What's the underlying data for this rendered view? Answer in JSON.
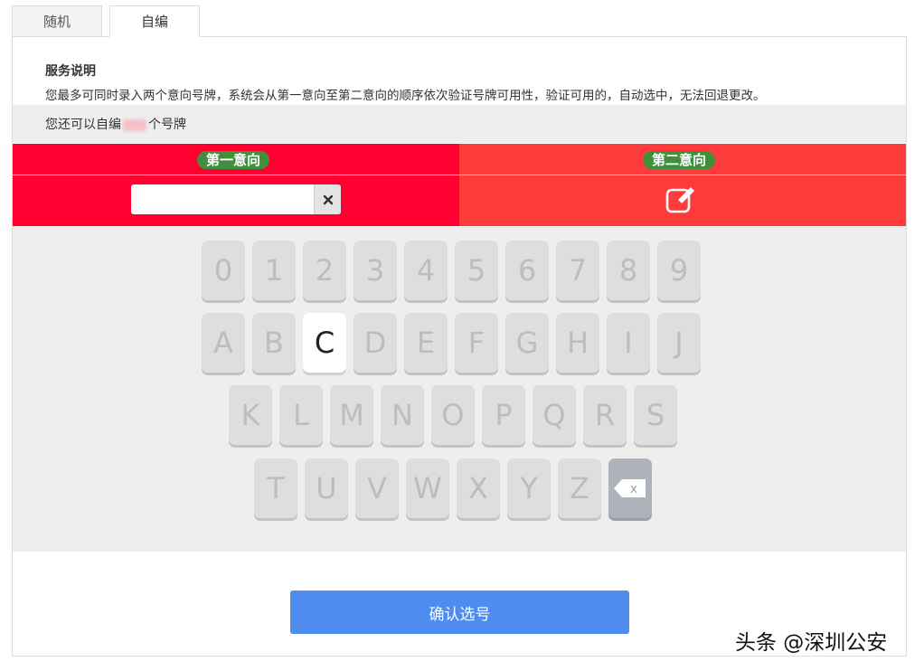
{
  "tabs": [
    {
      "label": "随机",
      "active": false
    },
    {
      "label": "自编",
      "active": true
    }
  ],
  "service": {
    "title": "服务说明",
    "description": "您最多可同时录入两个意向号牌，系统会从第一意向至第二意向的顺序依次验证号牌可用性，验证可用的，自动选中，无法回退更改。"
  },
  "remain": {
    "prefix": "您还可以自编",
    "suffix": "个号牌"
  },
  "choices": {
    "first_label": "第一意向",
    "second_label": "第二意向",
    "first_value": "",
    "clear_icon": "close-icon",
    "edit_icon": "edit-icon"
  },
  "keyboard": {
    "rows": [
      [
        "0",
        "1",
        "2",
        "3",
        "4",
        "5",
        "6",
        "7",
        "8",
        "9"
      ],
      [
        "A",
        "B",
        "C",
        "D",
        "E",
        "F",
        "G",
        "H",
        "I",
        "J"
      ],
      [
        "K",
        "L",
        "M",
        "N",
        "O",
        "P",
        "Q",
        "R",
        "S"
      ],
      [
        "T",
        "U",
        "V",
        "W",
        "X",
        "Y",
        "Z"
      ]
    ],
    "active_key": "C",
    "backspace_icon": "backspace-icon",
    "backspace_label": "x"
  },
  "confirm_label": "确认选号",
  "watermark": "头条 @深圳公安",
  "colors": {
    "first_bg": "#ff0030",
    "second_bg": "#ff3a3a",
    "pill_bg": "#3f8f3c",
    "confirm_bg": "#4e8cf0"
  }
}
